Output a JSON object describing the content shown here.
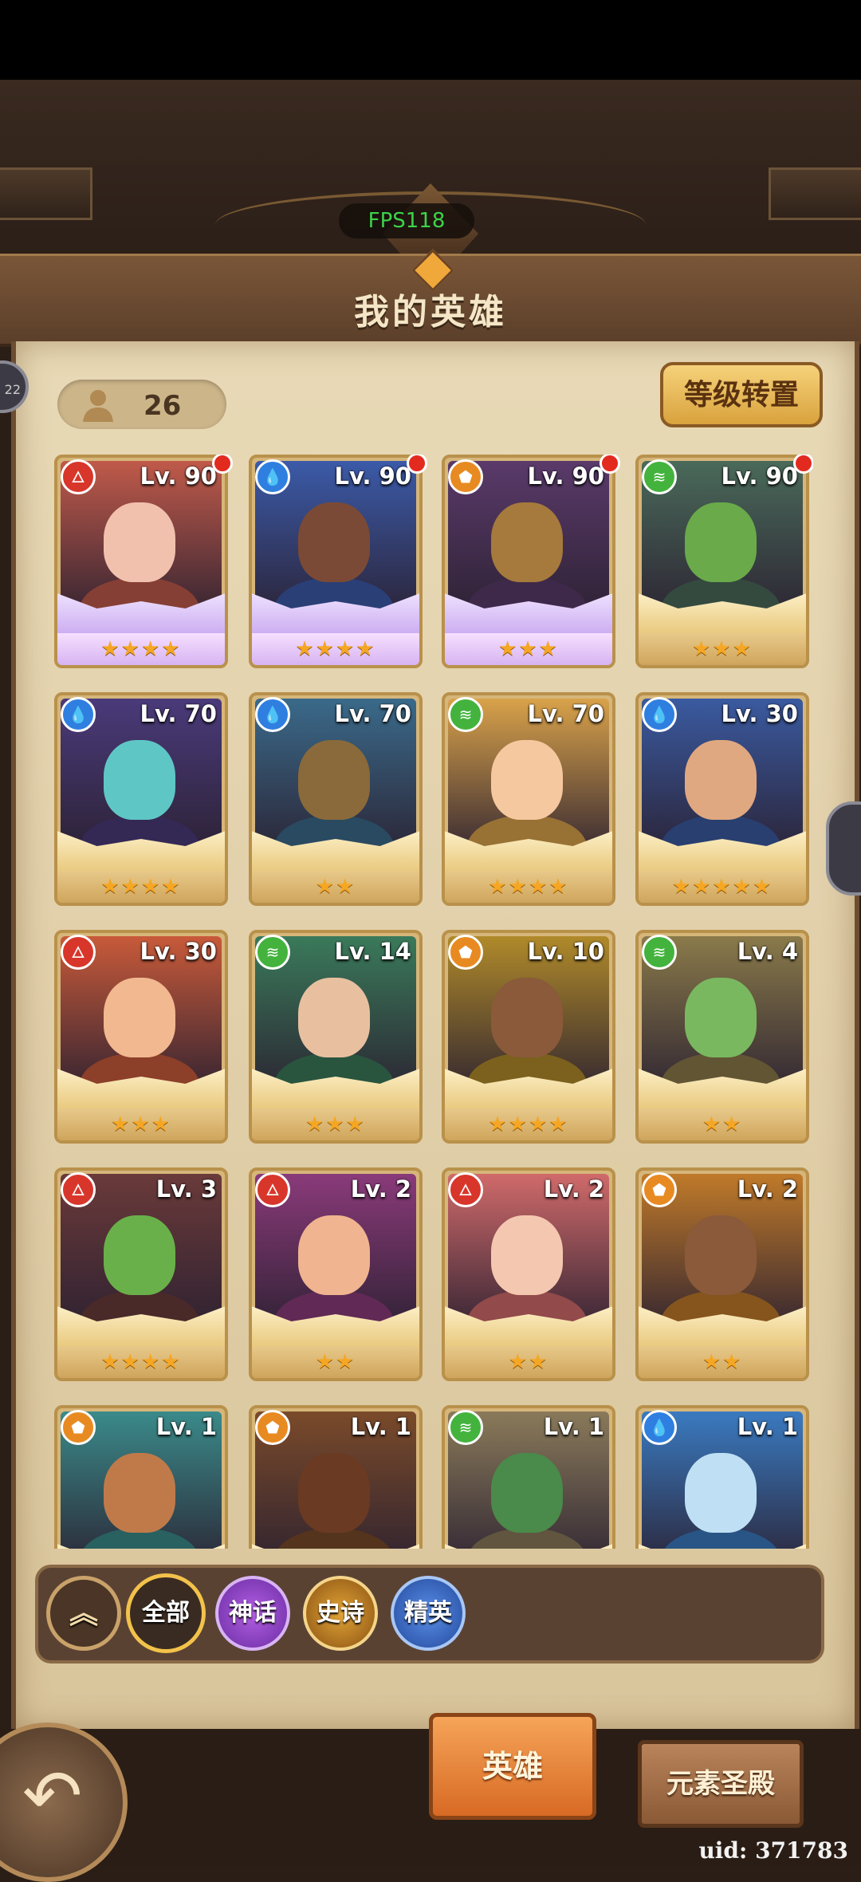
{
  "fps": "FPS118",
  "title": "我的英雄",
  "hero_count": "26",
  "level_transfer_label": "等级转置",
  "side_badge": "22",
  "heroes": [
    {
      "level": "Lv. 90",
      "element": "fire",
      "stars": "★★★★",
      "tier": "mythic",
      "notify": true,
      "skin": "#f2c1ae",
      "bg": "#c05a4a"
    },
    {
      "level": "Lv. 90",
      "element": "water",
      "stars": "★★★★",
      "tier": "mythic",
      "notify": true,
      "skin": "#7a4a36",
      "bg": "#3b5aa8"
    },
    {
      "level": "Lv. 90",
      "element": "earth",
      "stars": "★★★",
      "tier": "mythic",
      "notify": true,
      "skin": "#a57a3c",
      "bg": "#5a3a6a"
    },
    {
      "level": "Lv. 90",
      "element": "wind",
      "stars": "★★★",
      "tier": "epic",
      "notify": true,
      "skin": "#6aaa4a",
      "bg": "#4a6a5a"
    },
    {
      "level": "Lv. 70",
      "element": "water",
      "stars": "★★★★",
      "tier": "epic",
      "notify": false,
      "skin": "#5fc6c6",
      "bg": "#4a3a7a"
    },
    {
      "level": "Lv. 70",
      "element": "water",
      "stars": "★★",
      "tier": "epic",
      "notify": false,
      "skin": "#8a6a3a",
      "bg": "#3a6a8a"
    },
    {
      "level": "Lv. 70",
      "element": "wind",
      "stars": "★★★★",
      "tier": "elite",
      "notify": false,
      "skin": "#f6c8a0",
      "bg": "#d9a24a"
    },
    {
      "level": "Lv. 30",
      "element": "water",
      "stars": "★★★★★",
      "tier": "epic",
      "notify": false,
      "skin": "#e0a880",
      "bg": "#3a5aa0"
    },
    {
      "level": "Lv. 30",
      "element": "fire",
      "stars": "★★★",
      "tier": "epic",
      "notify": false,
      "skin": "#f2b890",
      "bg": "#c85a3a"
    },
    {
      "level": "Lv. 14",
      "element": "wind",
      "stars": "★★★",
      "tier": "epic",
      "notify": false,
      "skin": "#e8c0a0",
      "bg": "#3a7a5a"
    },
    {
      "level": "Lv. 10",
      "element": "earth",
      "stars": "★★★★",
      "tier": "elite",
      "notify": false,
      "skin": "#8a5a3a",
      "bg": "#b08a2a"
    },
    {
      "level": "Lv. 4",
      "element": "wind",
      "stars": "★★",
      "tier": "epic",
      "notify": false,
      "skin": "#7ab860",
      "bg": "#8a7a4a"
    },
    {
      "level": "Lv. 3",
      "element": "fire",
      "stars": "★★★★",
      "tier": "elite",
      "notify": false,
      "skin": "#6ab04a",
      "bg": "#6a3a3a"
    },
    {
      "level": "Lv. 2",
      "element": "fire",
      "stars": "★★",
      "tier": "epic",
      "notify": false,
      "skin": "#f0b490",
      "bg": "#8a3a7a"
    },
    {
      "level": "Lv. 2",
      "element": "fire",
      "stars": "★★",
      "tier": "epic",
      "notify": false,
      "skin": "#f4c8b0",
      "bg": "#d06a6a"
    },
    {
      "level": "Lv. 2",
      "element": "earth",
      "stars": "★★",
      "tier": "epic",
      "notify": false,
      "skin": "#8a5a3a",
      "bg": "#c07a2a"
    },
    {
      "level": "Lv. 1",
      "element": "earth",
      "stars": "",
      "tier": "epic",
      "notify": false,
      "skin": "#c07a4a",
      "bg": "#3a8a8a"
    },
    {
      "level": "Lv. 1",
      "element": "earth",
      "stars": "",
      "tier": "epic",
      "notify": false,
      "skin": "#6a3a22",
      "bg": "#7a4a2a"
    },
    {
      "level": "Lv. 1",
      "element": "wind",
      "stars": "",
      "tier": "epic",
      "notify": false,
      "skin": "#4a8a4a",
      "bg": "#8a7a5a"
    },
    {
      "level": "Lv. 1",
      "element": "water",
      "stars": "",
      "tier": "epic",
      "notify": false,
      "skin": "#bfe0f4",
      "bg": "#3a7ac0"
    }
  ],
  "filters": {
    "collapse": "︽",
    "all": "全部",
    "mythic": "神话",
    "epic": "史诗",
    "elite": "精英"
  },
  "tabs": {
    "heroes": "英雄",
    "temple": "元素圣殿"
  },
  "back_icon": "back-arrow-icon",
  "uid": "uid: 371783",
  "colors": {
    "fire": "#d8362b",
    "water": "#2f7fe0",
    "earth": "#e88a22",
    "wind": "#43b33d",
    "accent": "#f2c24a"
  }
}
